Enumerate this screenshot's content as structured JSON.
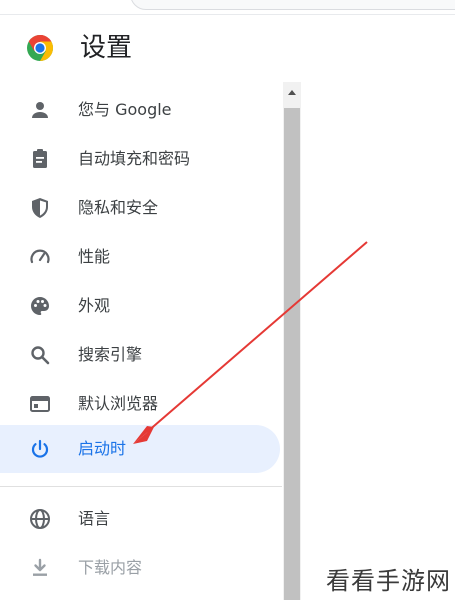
{
  "header": {
    "title": "设置"
  },
  "sidebar": {
    "items": [
      {
        "label": "您与 Google",
        "icon": "person-icon"
      },
      {
        "label": "自动填充和密码",
        "icon": "clipboard-icon"
      },
      {
        "label": "隐私和安全",
        "icon": "shield-icon"
      },
      {
        "label": "性能",
        "icon": "speedometer-icon"
      },
      {
        "label": "外观",
        "icon": "palette-icon"
      },
      {
        "label": "搜索引擎",
        "icon": "search-icon"
      },
      {
        "label": "默认浏览器",
        "icon": "browser-window-icon"
      },
      {
        "label": "启动时",
        "icon": "power-icon",
        "active": true
      },
      {
        "label": "语言",
        "icon": "globe-icon"
      },
      {
        "label": "下载内容",
        "icon": "download-icon"
      }
    ]
  },
  "annotation": {
    "arrow_color": "#e53935"
  },
  "watermark": {
    "text": "看看手游网"
  },
  "colors": {
    "accent": "#1a73e8",
    "active_bg": "#e8f0fe",
    "icon": "#5f6368",
    "text": "#3c4043"
  }
}
